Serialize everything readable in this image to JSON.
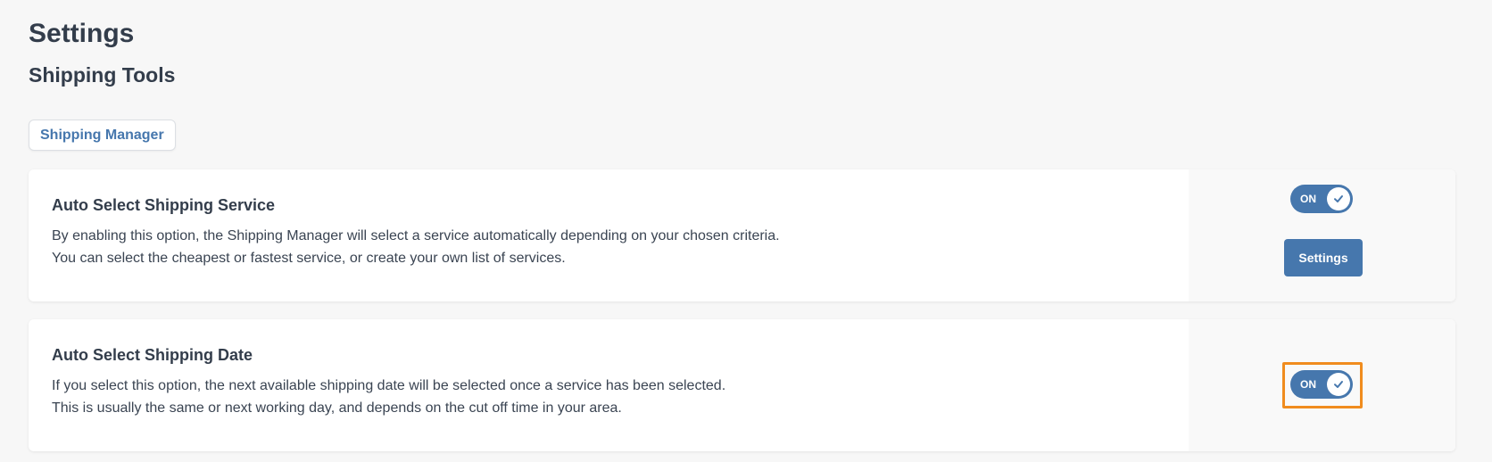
{
  "header": {
    "title": "Settings",
    "section": "Shipping Tools"
  },
  "tabs": [
    {
      "label": "Shipping Manager"
    }
  ],
  "cards": [
    {
      "title": "Auto Select Shipping Service",
      "description_lines": [
        "By enabling this option, the Shipping Manager will select a service automatically depending on your chosen criteria.",
        "You can select the cheapest or fastest service, or create your own list of services."
      ],
      "toggle_label": "ON",
      "toggle_on": true,
      "button_label": "Settings"
    },
    {
      "title": "Auto Select Shipping Date",
      "description_lines": [
        "If you select this option, the next available shipping date will be selected once a service has been selected.",
        "This is usually the same or next working day, and depends on the cut off time in your area."
      ],
      "toggle_label": "ON",
      "toggle_on": true
    }
  ],
  "colors": {
    "accent": "#4677ad",
    "focus": "#f08c1e",
    "background": "#f7f7f7"
  },
  "icons": {
    "toggle_knob": "check-icon"
  }
}
